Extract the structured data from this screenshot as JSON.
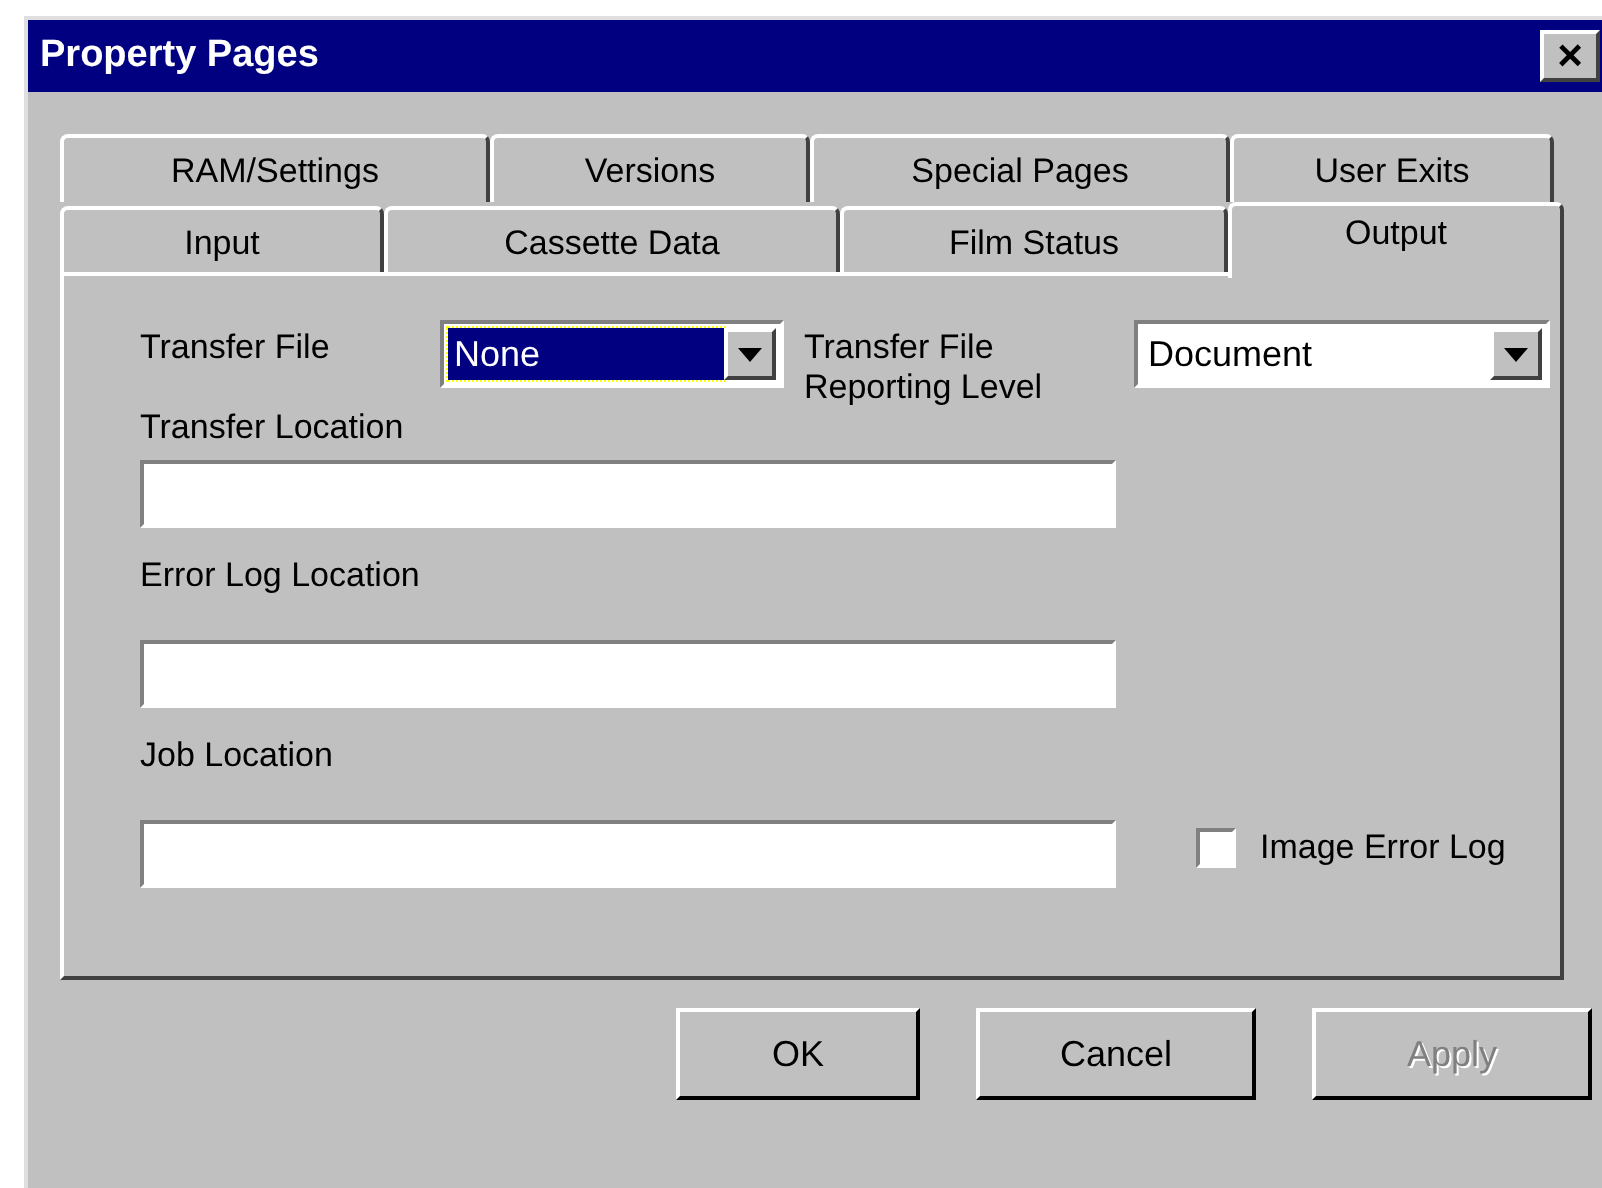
{
  "window": {
    "title": "Property Pages",
    "close": "×"
  },
  "tab_rows": [
    [
      {
        "label": "RAM/Settings",
        "selected": false
      },
      {
        "label": "Versions",
        "selected": false
      },
      {
        "label": "Special Pages",
        "selected": false
      },
      {
        "label": "User Exits",
        "selected": false
      }
    ],
    [
      {
        "label": "Input",
        "selected": false
      },
      {
        "label": "Cassette Data",
        "selected": false
      },
      {
        "label": "Film Status",
        "selected": false
      },
      {
        "label": "Output",
        "selected": true
      }
    ]
  ],
  "transfer_file": {
    "label": "Transfer File",
    "value": "None",
    "focused": true
  },
  "reporting_level": {
    "label": "Transfer File Reporting Level",
    "value": "Document",
    "focused": false
  },
  "fields": [
    {
      "label": "Transfer Location"
    },
    {
      "label": "Error Log Location"
    },
    {
      "label": "Job Location"
    }
  ],
  "image_error_log": {
    "label": "Image Error Log",
    "checked": false
  },
  "buttons": [
    {
      "label": "OK",
      "disabled": false
    },
    {
      "label": "Cancel",
      "disabled": false
    },
    {
      "label": "Apply",
      "disabled": true
    }
  ]
}
